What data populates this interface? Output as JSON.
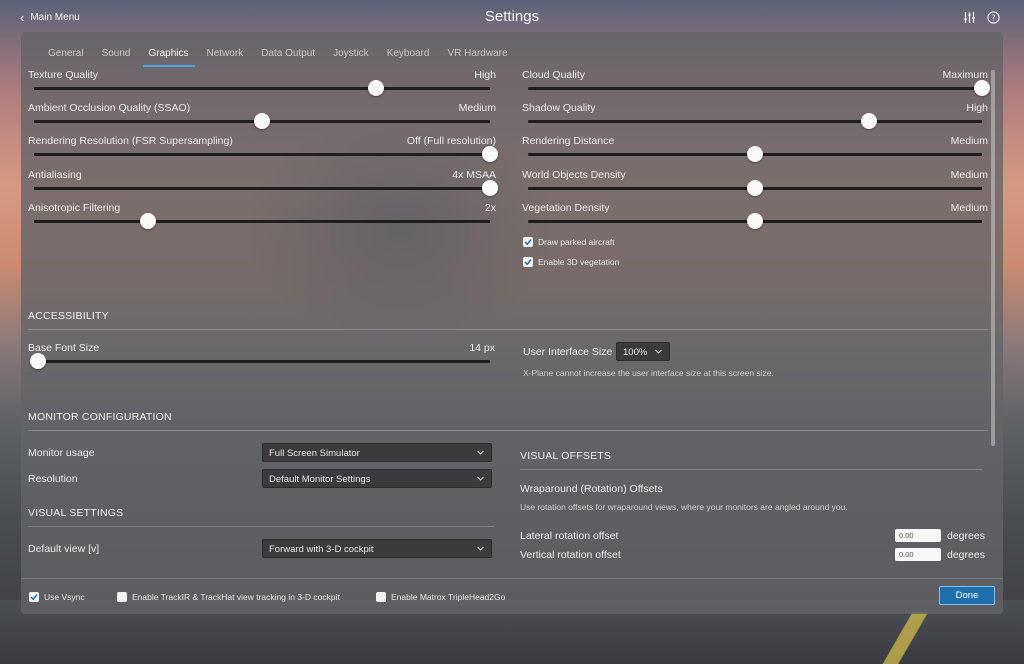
{
  "window": {
    "title": "Settings",
    "back_label": "Main Menu"
  },
  "tabs": [
    {
      "label": "General",
      "active": false
    },
    {
      "label": "Sound",
      "active": false
    },
    {
      "label": "Graphics",
      "active": true
    },
    {
      "label": "Network",
      "active": false
    },
    {
      "label": "Data Output",
      "active": false
    },
    {
      "label": "Joystick",
      "active": false
    },
    {
      "label": "Keyboard",
      "active": false
    },
    {
      "label": "VR Hardware",
      "active": false
    }
  ],
  "sliders_left": [
    {
      "label": "Texture Quality",
      "value": "High",
      "level": 0.75
    },
    {
      "label": "Ambient Occlusion Quality (SSAO)",
      "value": "Medium",
      "level": 0.5
    },
    {
      "label": "Rendering Resolution (FSR Supersampling)",
      "value": "Off (Full resolution)",
      "level": 1.0
    },
    {
      "label": "Antialiasing",
      "value": "4x MSAA",
      "level": 1.0
    },
    {
      "label": "Anisotropic Filtering",
      "value": "2x",
      "level": 0.25
    }
  ],
  "sliders_right": [
    {
      "label": "Cloud Quality",
      "value": "Maximum",
      "level": 1.0
    },
    {
      "label": "Shadow Quality",
      "value": "High",
      "level": 0.75
    },
    {
      "label": "Rendering Distance",
      "value": "Medium",
      "level": 0.5
    },
    {
      "label": "World Objects Density",
      "value": "Medium",
      "level": 0.5
    },
    {
      "label": "Vegetation Density",
      "value": "Medium",
      "level": 0.5
    }
  ],
  "checkboxes_graphics": [
    {
      "label": "Draw parked aircraft",
      "checked": true
    },
    {
      "label": "Enable 3D vegetation",
      "checked": true
    }
  ],
  "accessibility": {
    "heading": "ACCESSIBILITY",
    "font_size_label": "Base Font Size",
    "font_size_value": "14 px",
    "font_size_level": 0.0,
    "ui_size_label": "User Interface Size",
    "ui_size_value": "100%",
    "ui_size_hint": "X-Plane cannot increase the user interface size at this screen size."
  },
  "monitor": {
    "heading": "MONITOR CONFIGURATION",
    "usage_label": "Monitor usage",
    "usage_value": "Full Screen Simulator",
    "resolution_label": "Resolution",
    "resolution_value": "Default Monitor Settings"
  },
  "visual_settings": {
    "heading": "VISUAL SETTINGS",
    "default_view_label": "Default view [v]",
    "default_view_value": "Forward with 3-D cockpit"
  },
  "visual_offsets": {
    "heading": "VISUAL OFFSETS",
    "subheading": "Wraparound (Rotation) Offsets",
    "description": "Use rotation offsets for wraparound views, where your monitors are angled around you.",
    "rows": [
      {
        "label": "Lateral rotation offset",
        "value": "0.00",
        "unit": "degrees"
      },
      {
        "label": "Vertical rotation offset",
        "value": "0.00",
        "unit": "degrees"
      }
    ]
  },
  "footer": {
    "checkboxes": [
      {
        "label": "Use Vsync",
        "checked": true
      },
      {
        "label": "Enable TrackIR & TrackHat view tracking in 3-D cockpit",
        "checked": false
      },
      {
        "label": "Enable Matrox TripleHead2Go",
        "checked": false
      }
    ],
    "done_label": "Done"
  },
  "colors": {
    "accent": "#4aa3e0",
    "done_button": "#1d6fae",
    "panel": "#646468"
  },
  "icons": {
    "back": "chevron-left-icon",
    "sliders": "sliders-icon",
    "help": "help-circle-icon"
  }
}
